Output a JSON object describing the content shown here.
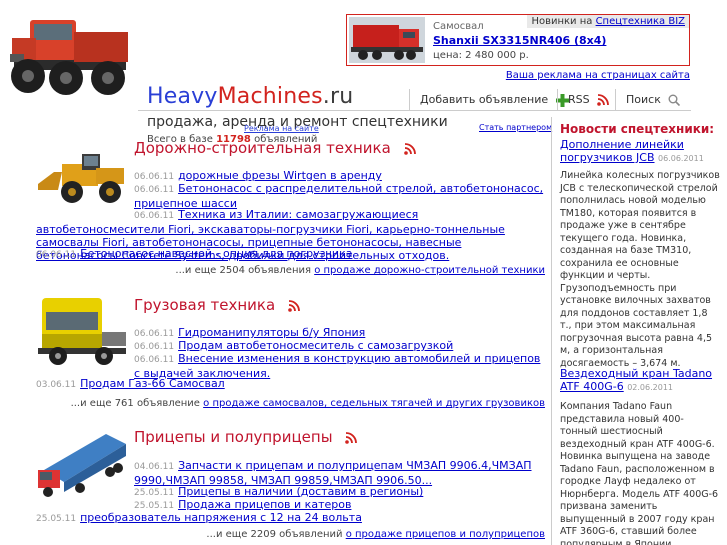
{
  "logo": {
    "heavy": "Heavy",
    "machines": "Machines",
    "ru": ".ru"
  },
  "tagline": "продажа, аренда и ремонт спецтехники",
  "ad": {
    "caption": "Самосвал",
    "title": "Shanxii SX3315NR406 (8x4)",
    "price": "цена: 2 480 000 р.",
    "new_label": "Новинки на",
    "new_link": "Спецтехника BIZ",
    "promo_link": "Ваша реклама на страницах сайта"
  },
  "menu": {
    "add": "Добавить объявление",
    "rss": "RSS",
    "search": "Поиск"
  },
  "partner_link": "Стать партнером",
  "reklama": "Реклама на сайте",
  "base": {
    "prefix": "Всего в базе",
    "count": "11798",
    "suffix": "объявлений"
  },
  "sections": [
    {
      "title": "Дорожно-строительная техника",
      "image": "wheel-loader",
      "items": [
        {
          "date": "06.06.11",
          "text": "дорожные фрезы Wirtgen в аренду"
        },
        {
          "date": "06.06.11",
          "text": "Бетононасос с распределительной стрелой, автобетононасос, прицепное шасси"
        },
        {
          "date": "06.06.11",
          "text": "Техника из Италии: самозагружающиеся автобетоносмесители Fiori, экскаваторы-погрузчики Fiori, карьерно-тоннельные самосвалы Fiori, автобетононасосы, прицепные бетононасосы, навесные бетононасосы Concrete Systems, дробилки для строительных отходов."
        },
        {
          "date": "06.06.11",
          "text": "Бетононасос навесной - опция для погрузчика"
        }
      ],
      "more_prefix": "...и еще 2504 объявления",
      "more_link": "о продаже дорожно-строительной техники"
    },
    {
      "title": "Грузовая техника",
      "image": "truck-tractor",
      "items": [
        {
          "date": "06.06.11",
          "text": "Гидроманипуляторы б/у Япония"
        },
        {
          "date": "06.06.11",
          "text": "Продам автобетоносмеситель с самозагрузкой"
        },
        {
          "date": "06.06.11",
          "text": "Внесение изменения в конструкцию автомобилей и прицепов с выдачей заключения."
        },
        {
          "date": "03.06.11",
          "text": "Продам Газ-66 Самосвал"
        }
      ],
      "more_prefix": "...и еще 761 объявление",
      "more_link": "о продаже самосвалов, седельных тягачей и других грузовиков"
    },
    {
      "title": "Прицепы и полуприцепы",
      "image": "semi-trailer",
      "items": [
        {
          "date": "04.06.11",
          "text": "Запчасти к прицепам и полуприцепам ЧМЗАП 9906.4,ЧМЗАП 9990,ЧМЗАП 99858, ЧМЗАП 99859,ЧМЗАП 9906.50..."
        },
        {
          "date": "25.05.11",
          "text": "Прицепы в наличии (доставим в регионы)"
        },
        {
          "date": "25.05.11",
          "text": "Продажа прицепов и катеров"
        },
        {
          "date": "25.05.11",
          "text": "преобразователь напряжения с 12 на 24 вольта"
        }
      ],
      "more_prefix": "...и еще 2209 объявлений",
      "more_link": "о продаже прицепов и полуприцепов"
    }
  ],
  "sidebar": {
    "heading": "Новости спецтехники:",
    "news": [
      {
        "title": "Дополнение линейки погрузчиков JCB",
        "date": "06.06.2011",
        "text": "Линейка колесных погрузчиков JCB с телескопической стрелой пополнилась новой моделью TM180, которая появится в продаже уже в сентябре текущего года. Новинка, созданная на базе TM310, сохранила ее основные функции и черты. Грузоподъемность при установке вилочных захватов для поддонов составляет 1,8 т., при этом максимальная погрузочная высота равна 4,5 м, а горизонтальная досягаемость – 3,674 м."
      },
      {
        "title": "Вездеходный кран Tadano ATF 400G-6",
        "date": "02.06.2011",
        "text": "Компания Tadano Faun представила новый 400-тонный шестиосный вездеходный кран ATF 400G-6. Новинка выпущена на заводе Tadano Faun, расположенном в городке Лауф недалеко от Нюрнберга. Модель ATF 400G-6 призвана заменить выпущенный в 2007 году кран ATF 360G-6, ставший более популярным в Японии,"
      }
    ]
  },
  "colors": {
    "brand_blue": "#2a3fd6",
    "brand_red": "#d2231e",
    "section_red": "#c0142d",
    "link": "#0000cc"
  }
}
